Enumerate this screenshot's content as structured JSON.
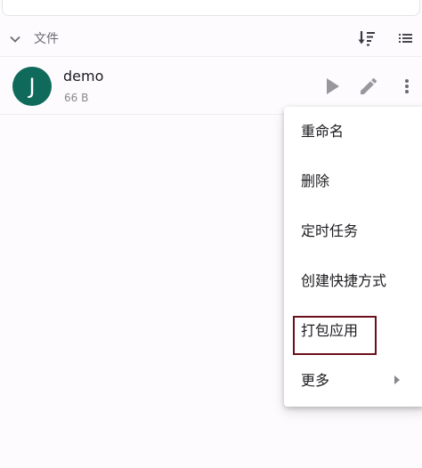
{
  "section": {
    "title": "文件",
    "icons": {
      "collapse": "chevron-down-icon",
      "sort": "sort-descending-icon",
      "view": "list-view-icon"
    }
  },
  "file": {
    "avatar_letter": "J",
    "name": "demo",
    "size": "66 B",
    "avatar_color": "#0f6a5b",
    "icons": {
      "run": "play-icon",
      "edit": "pencil-icon",
      "more": "more-vertical-icon"
    }
  },
  "menu": {
    "items": [
      {
        "label": "重命名"
      },
      {
        "label": "删除"
      },
      {
        "label": "定时任务"
      },
      {
        "label": "创建快捷方式"
      },
      {
        "label": "打包应用"
      },
      {
        "label": "更多",
        "has_submenu": true
      }
    ],
    "highlighted_item": "打包应用",
    "highlight_color": "#6b0f1a",
    "icons": {
      "submenu": "chevron-right-icon"
    }
  }
}
